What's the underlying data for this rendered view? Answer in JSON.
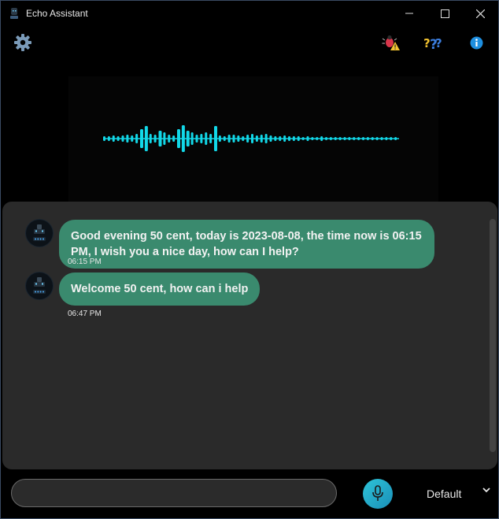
{
  "window": {
    "title": "Echo Assistant",
    "minimize_glyph": "—",
    "maximize_glyph": "☐",
    "close_glyph": "✕"
  },
  "toolbar": {
    "settings_icon": "gear-icon",
    "bug_icon": "bug-report-icon",
    "help_icon": "help-icon",
    "info_icon": "info-icon"
  },
  "visualizer": {
    "color": "#12d8e8"
  },
  "chat": {
    "messages": [
      {
        "text": "Good evening 50 cent, today is 2023-08-08, the time now is 06:15 PM, I wish you a nice day, how can I help?",
        "time": "06:15 PM"
      },
      {
        "text": "Welcome 50 cent, how can i help",
        "time": "06:47 PM"
      }
    ]
  },
  "input": {
    "value": "",
    "placeholder": ""
  },
  "voice": {
    "selected": "Default",
    "chevron": "⌄"
  },
  "colors": {
    "bubble": "#3a8a6e",
    "chat_bg": "#2a2a2a",
    "accent": "#2ec4d8"
  }
}
